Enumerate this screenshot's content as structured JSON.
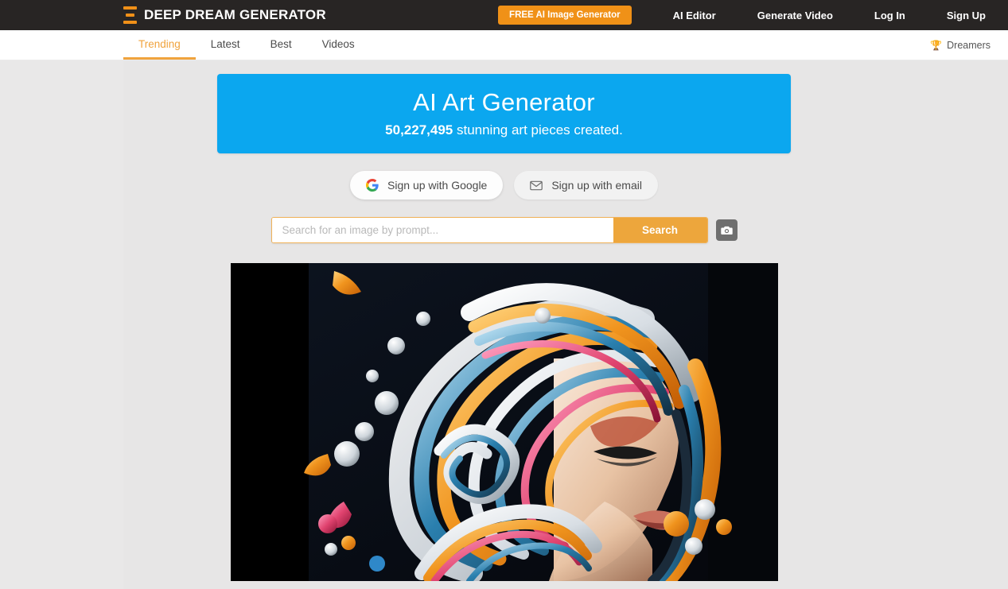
{
  "header": {
    "brand_name": "DEEP DREAM GENERATOR",
    "logo_icon": "stacked-bars-icon",
    "cta_label": "FREE AI Image Generator",
    "nav": [
      {
        "label": "AI Editor"
      },
      {
        "label": "Generate Video"
      },
      {
        "label": "Log In"
      },
      {
        "label": "Sign Up"
      }
    ],
    "bg_color": "#282524",
    "accent_color": "#f09117"
  },
  "subnav": {
    "tabs": [
      {
        "label": "Trending",
        "active": true
      },
      {
        "label": "Latest",
        "active": false
      },
      {
        "label": "Best",
        "active": false
      },
      {
        "label": "Videos",
        "active": false
      }
    ],
    "dreamers": {
      "label": "Dreamers",
      "icon": "trophy-icon"
    },
    "active_color": "#f0a33d"
  },
  "hero": {
    "title": "AI Art Generator",
    "count": "50,227,495",
    "subtitle_suffix": " stunning art pieces created.",
    "bg_color": "#0ba7ef"
  },
  "signup": {
    "google_label": "Sign up with Google",
    "google_icon": "google-g-icon",
    "email_label": "Sign up with email",
    "email_icon": "envelope-icon"
  },
  "search": {
    "placeholder": "Search for an image by prompt...",
    "value": "",
    "button_label": "Search",
    "camera_icon": "camera-icon",
    "border_color": "#f0b157",
    "button_color": "#eda63c"
  },
  "artwork": {
    "alt": "Abstract swirling colorful portrait of a woman's face with flowing paint-like hair",
    "background": "#000000"
  }
}
